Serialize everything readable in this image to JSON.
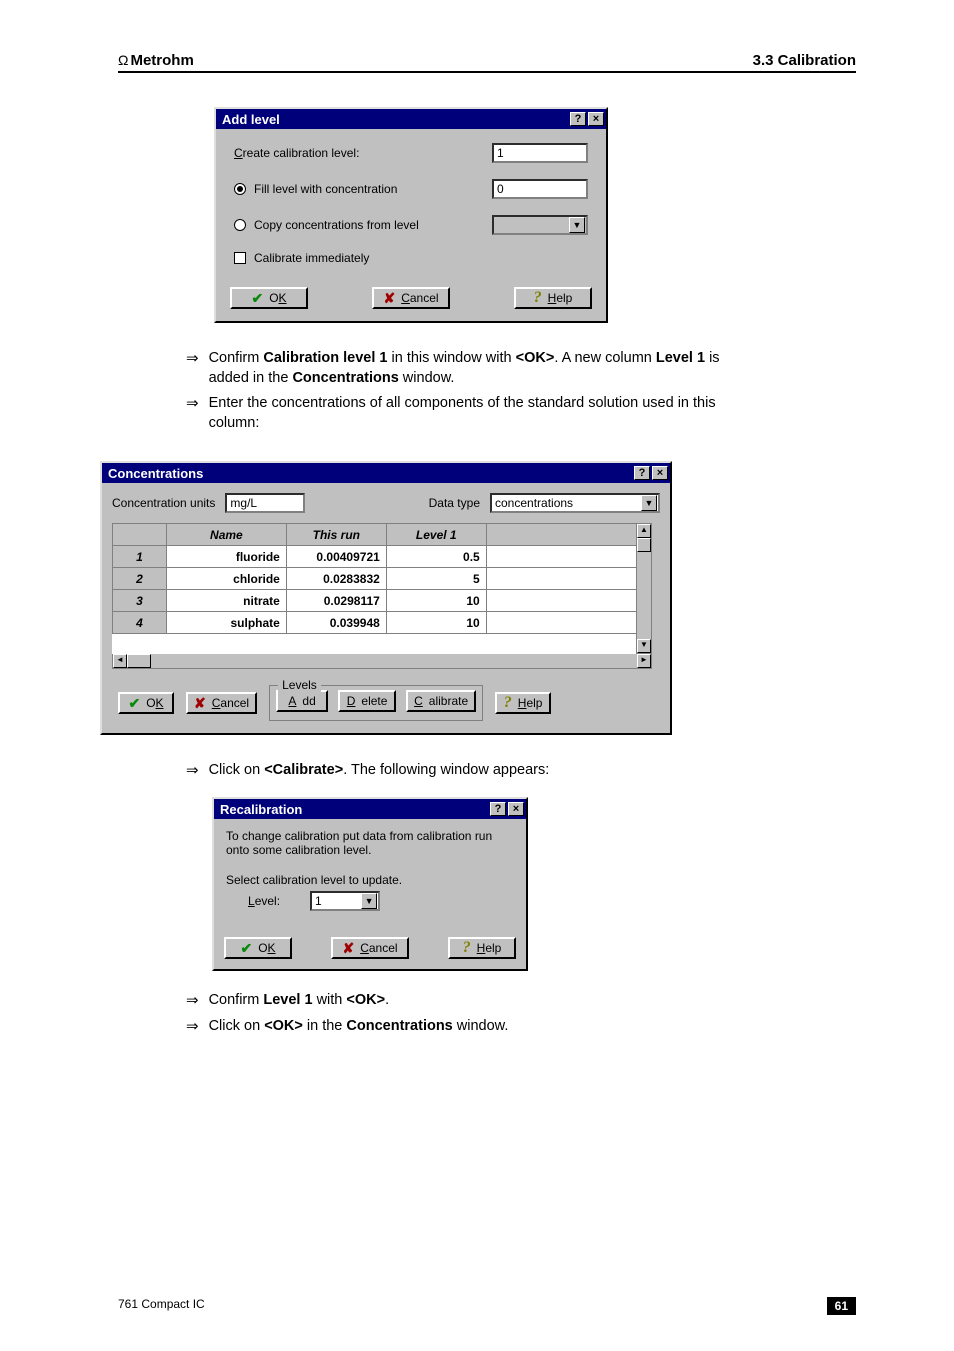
{
  "header": {
    "brand": "Metrohm",
    "section": "3.3 Calibration"
  },
  "addLevel": {
    "title": "Add level",
    "createLabel_pre": "C",
    "createLabel_rest": "reate calibration level:",
    "createValue": "1",
    "opt_fill": "Fill level with concentration",
    "fillValue": "0",
    "opt_copy": "Copy concentrations from level",
    "copyValue": "",
    "chk_calib": "Calibrate immediately",
    "btn_ok_pre": "O",
    "btn_ok_u": "K",
    "btn_cancel_u": "C",
    "btn_cancel_rest": "ancel",
    "btn_help_u": "H",
    "btn_help_rest": "elp"
  },
  "text1_a": "Confirm ",
  "text1_b": "Calibration level 1",
  "text1_c": " in this window with ",
  "text1_d": "<OK>",
  "text1_e": ". A new column ",
  "text1_f": "Level 1",
  "text1_g": " is added in the ",
  "text1_h": "Concentrations",
  "text1_i": " window.",
  "text2": "Enter the concentrations of all components of the standard solution used in this column:",
  "conc": {
    "title": "Concentrations",
    "unitsLabel": "Concentration units",
    "unitsValue": "mg/L",
    "dataTypeLabel": "Data type",
    "dataTypeValue": "concentrations",
    "cols": {
      "name": "Name",
      "thisrun": "This run",
      "level1": "Level 1"
    },
    "rows": [
      {
        "i": "1",
        "name": "fluoride",
        "thisrun": "0.00409721",
        "level1": "0.5"
      },
      {
        "i": "2",
        "name": "chloride",
        "thisrun": "0.0283832",
        "level1": "5"
      },
      {
        "i": "3",
        "name": "nitrate",
        "thisrun": "0.0298117",
        "level1": "10"
      },
      {
        "i": "4",
        "name": "sulphate",
        "thisrun": "0.039948",
        "level1": "10"
      }
    ],
    "group": "Levels",
    "btn_ok_pre": "O",
    "btn_ok_u": "K",
    "btn_cancel_u": "C",
    "btn_cancel_rest": "ancel",
    "btn_add_u": "A",
    "btn_add_rest": "dd",
    "btn_del_u": "D",
    "btn_del_rest": "elete",
    "btn_calib_u": "C",
    "btn_calib_rest": "alibrate",
    "btn_help_u": "H",
    "btn_help_rest": "elp"
  },
  "text3_a": "Click on ",
  "text3_b": "<Calibrate>",
  "text3_c": ". The following window appears:",
  "recal": {
    "title": "Recalibration",
    "msg": "To change calibration put data from calibration run onto some calibration level.",
    "sel": "Select calibration level to update.",
    "level_u": "L",
    "level_rest": "evel:",
    "levelValue": "1",
    "btn_ok_pre": "O",
    "btn_ok_u": "K",
    "btn_cancel_u": "C",
    "btn_cancel_rest": "ancel",
    "btn_help_u": "H",
    "btn_help_rest": "elp"
  },
  "text4_a": "Confirm ",
  "text4_b": "Level 1",
  "text4_c": " with ",
  "text4_d": "<OK>",
  "text4_e": ".",
  "text5_a": "Click on ",
  "text5_b": "<OK>",
  "text5_c": " in the ",
  "text5_d": "Concentrations",
  "text5_e": " window.",
  "footer": {
    "product": "761 Compact IC",
    "page": "61"
  }
}
